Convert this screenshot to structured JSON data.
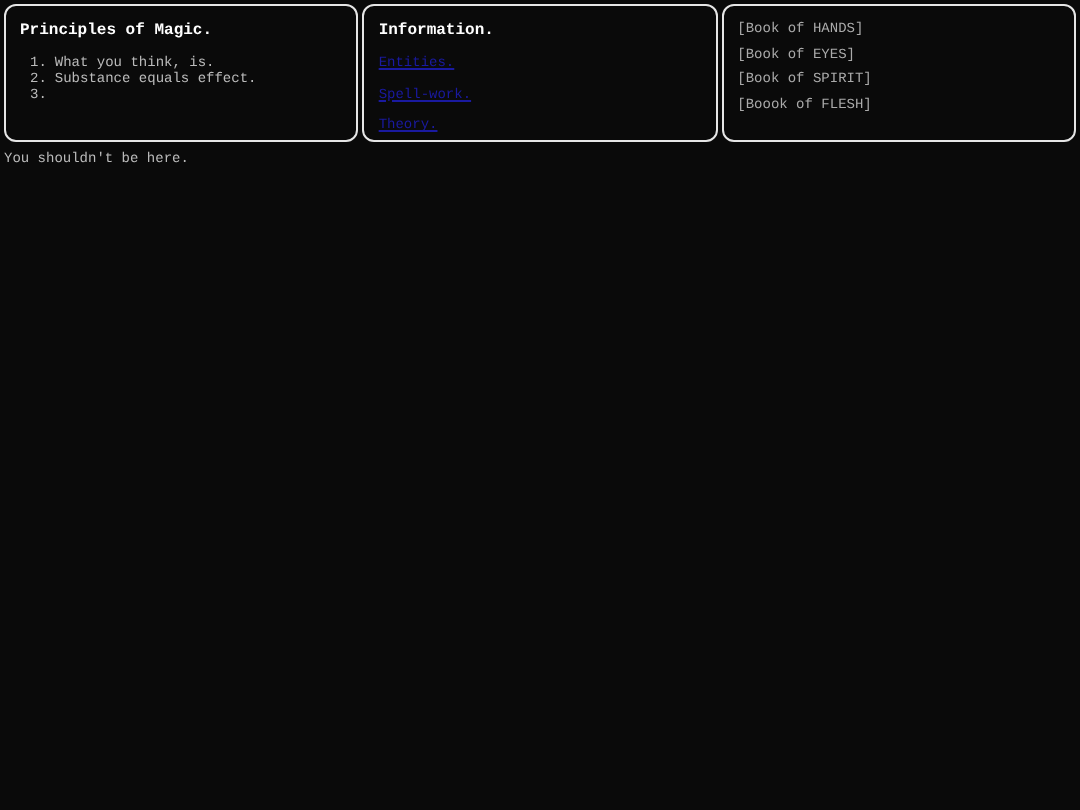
{
  "panels": [
    {
      "kind": "list",
      "title": "Principles of Magic.",
      "items": [
        {
          "marker": "1.",
          "text": "What you think, is."
        },
        {
          "marker": "2.",
          "text": "Substance equals effect."
        },
        {
          "marker": "3."
        }
      ]
    },
    {
      "kind": "links",
      "title": "Information.",
      "items": [
        "Entities.",
        "Spell-work.",
        "Theory."
      ]
    },
    {
      "kind": "books",
      "items": [
        "[Book of HANDS]",
        "[Book of EYES]",
        "[Book of SPIRIT]",
        "[Boook of FLESH]"
      ]
    }
  ],
  "footer": "You shouldn't be here."
}
